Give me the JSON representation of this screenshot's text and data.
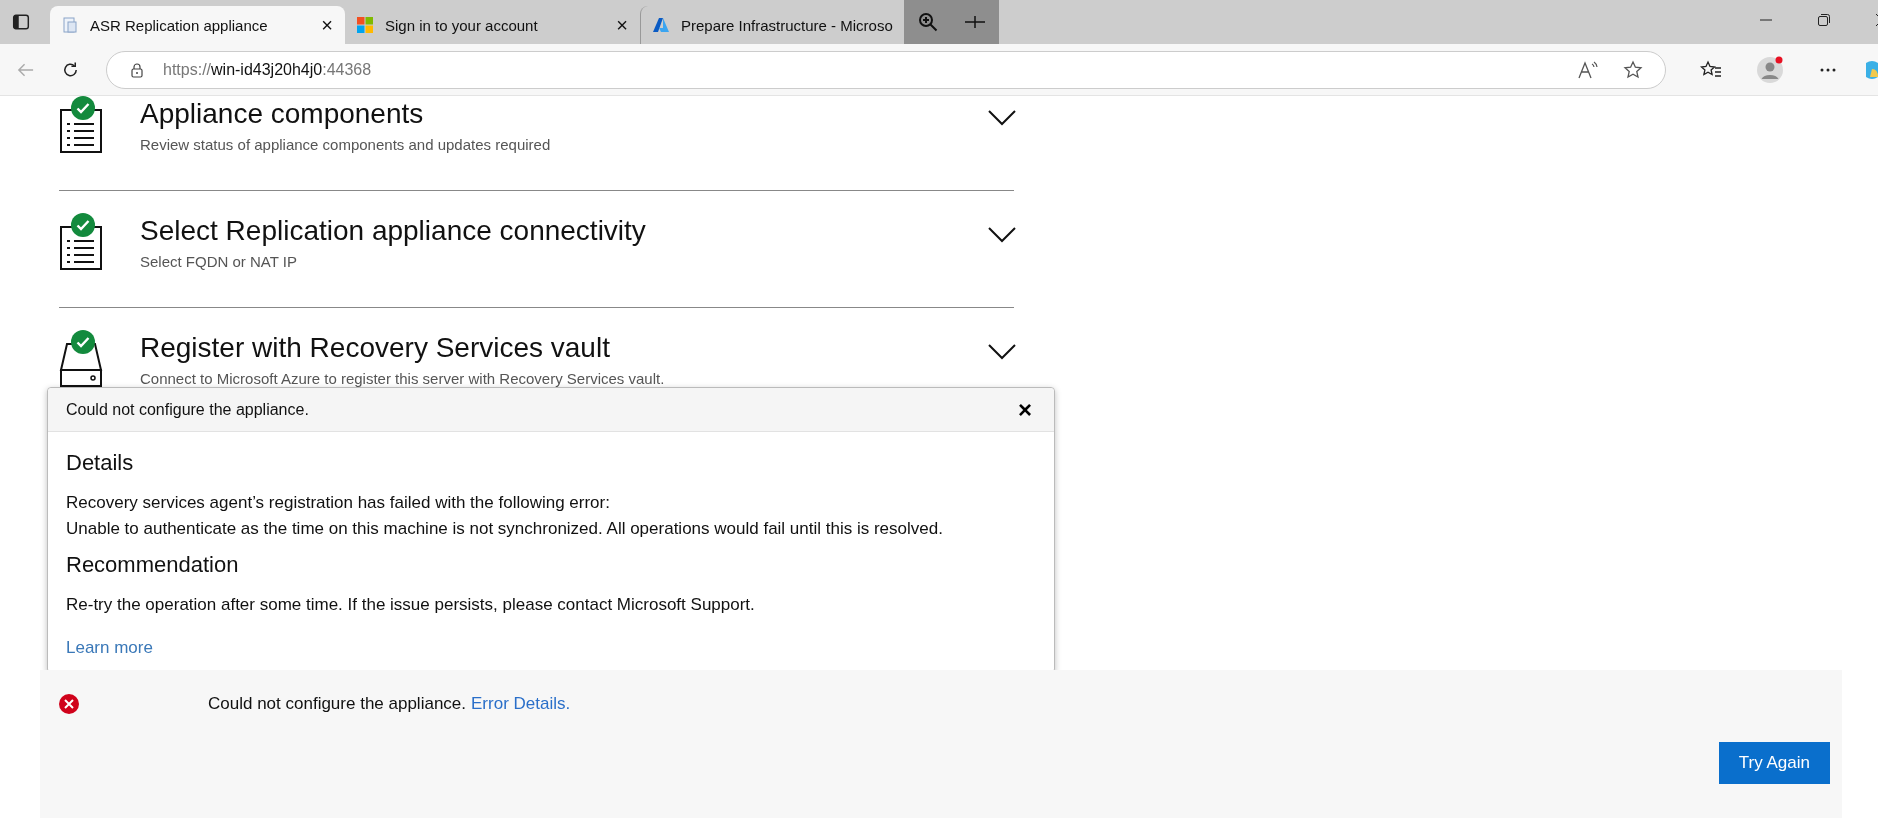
{
  "browser": {
    "tabs": [
      {
        "title": "ASR Replication appliance",
        "selected": true,
        "close": "×"
      },
      {
        "title": "Sign in to your account",
        "selected": false,
        "close": "×"
      },
      {
        "title": "Prepare Infrastructure - Microso",
        "selected": false
      }
    ],
    "address": {
      "scheme": "https://",
      "host": "win-id43j20h4j0",
      "port": ":44368"
    }
  },
  "sections": [
    {
      "title": "Appliance components",
      "description": "Review status of appliance components and updates required",
      "completed": true,
      "expanded": false
    },
    {
      "title": "Select Replication appliance connectivity",
      "description": "Select FQDN or NAT IP",
      "completed": true,
      "expanded": false
    },
    {
      "title": "Register with Recovery Services vault",
      "description": "Connect to Microsoft Azure to register this server with Recovery Services vault.",
      "completed": true,
      "expanded": false
    }
  ],
  "popup": {
    "title": "Could not configure the appliance.",
    "close": "×",
    "details_heading": "Details",
    "details_lines": [
      "Recovery services agent’s registration has failed with the following error:",
      "Unable to authenticate as the time on this machine is not synchronized. All operations would fail until this is resolved."
    ],
    "recommendation_heading": "Recommendation",
    "recommendation": "Re-try the operation after some time. If the issue persists, please contact Microsoft Support.",
    "link": "Learn more"
  },
  "status": {
    "message": "Could not configure the appliance.",
    "link": "Error Details.",
    "button": "Try Again"
  }
}
